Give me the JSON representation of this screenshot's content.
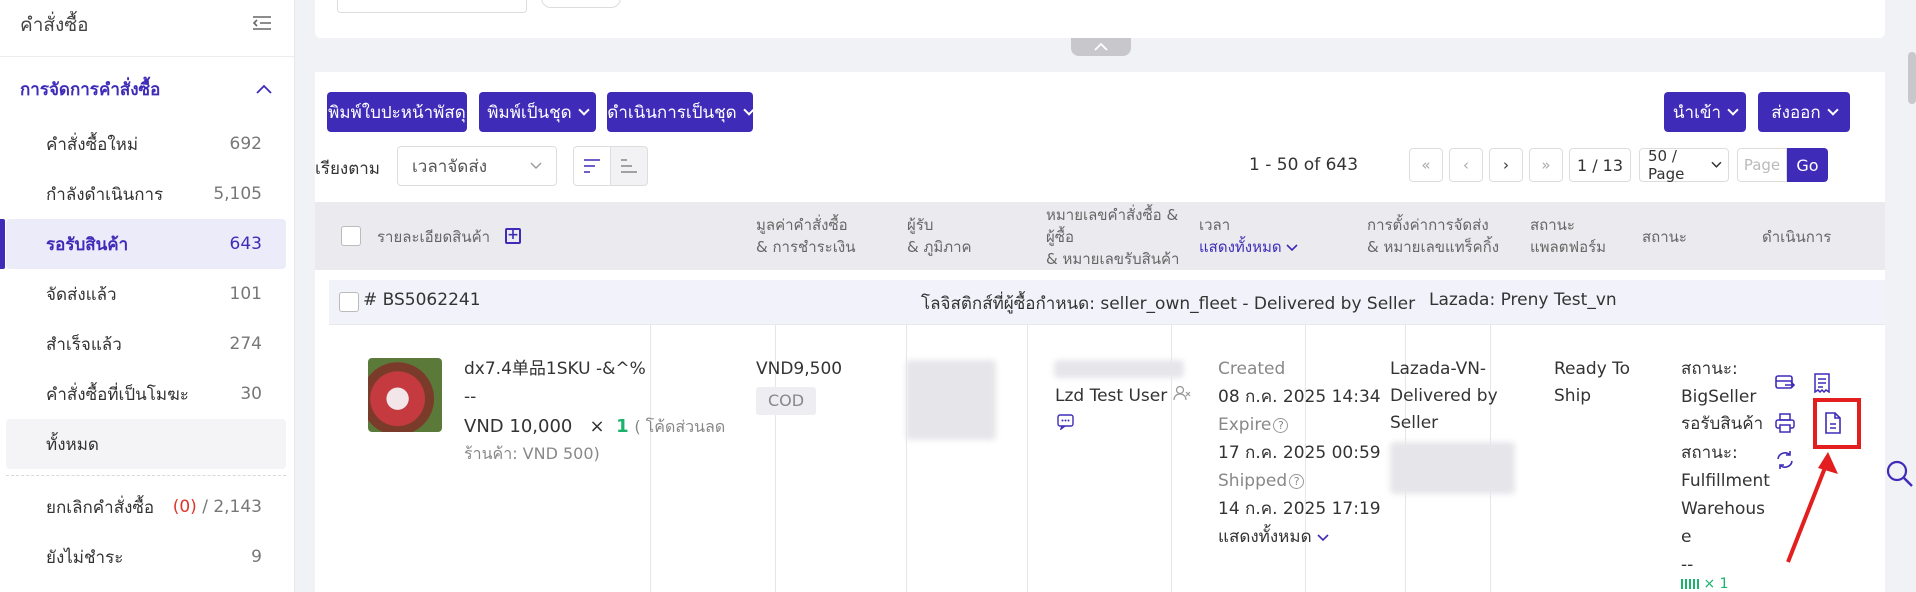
{
  "sidebar": {
    "title": "คำสั่งซื้อ",
    "section": "การจัดการคำสั่งซื้อ",
    "items": [
      {
        "label": "คำสั่งซื้อใหม่",
        "count": "692"
      },
      {
        "label": "กำลังดำเนินการ",
        "count": "5,105"
      },
      {
        "label": "รอรับสินค้า",
        "count": "643"
      },
      {
        "label": "จัดส่งแล้ว",
        "count": "101"
      },
      {
        "label": "สำเร็จแล้ว",
        "count": "274"
      },
      {
        "label": "คำสั่งซื้อที่เป็นโมฆะ",
        "count": "30"
      },
      {
        "label": "ทั้งหมด",
        "count": ""
      }
    ],
    "cancel": {
      "label": "ยกเลิกคำสั่งซื้อ",
      "count_red": "(0)",
      "sep": "/",
      "total": "2,143"
    },
    "unpaid": {
      "label": "ยังไม่ชำระ",
      "count": "9"
    }
  },
  "toolbar": {
    "print_label": "พิมพ์ใบปะหน้าพัสดุ",
    "print_batch": "พิมพ์เป็นชุด",
    "process_batch": "ดำเนินการเป็นชุด",
    "import": "นำเข้า",
    "export": "ส่งออก"
  },
  "sort": {
    "label": "เรียงตาม",
    "value": "เวลาจัดส่ง"
  },
  "pagination": {
    "range": "1 - 50 of 643",
    "page": "1 / 13",
    "per_page": "50 / Page",
    "goto_placeholder": "Page",
    "go": "Go"
  },
  "table": {
    "headers": {
      "product": "รายละเอียดสินค้า",
      "amount_1": "มูลค่าคำสั่งซื้อ",
      "amount_2": "& การชำระเงิน",
      "buyer_1": "ผู้รับ",
      "buyer_2": "& ภูมิภาค",
      "order_1": "หมายเลขคำสั่งซื้อ &",
      "order_2": "ผู้ซื้อ",
      "order_3": "& หมายเลขรับสินค้า",
      "time_1": "เวลา",
      "time_2": "แสดงทั้งหมด",
      "ship_1": "การตั้งค่าการจัดส่ง",
      "ship_2": "& หมายเลขแทร็คกิ้ง",
      "pstatus_1": "สถานะ",
      "pstatus_2": "แพลตฟอร์ม",
      "status": "สถานะ",
      "actions": "ดำเนินการ"
    },
    "order": {
      "id": "# BS5062241",
      "logistics": "โลจิสติกส์ที่ผู้ซื้อกำหนด: seller_own_fleet - Delivered by Seller",
      "store": "Lazada: Preny Test_vn",
      "product_name": "dx7.4单品1SKU -&^%",
      "product_sub": "--",
      "price": "VND 10,000",
      "times": "×",
      "qty": "1",
      "discount_1": "( โค้ดส่วนลด",
      "discount_2": "ร้านค้า: VND 500)",
      "amount": "VND9,500",
      "payment": "COD",
      "buyer": "Lzd Test User",
      "created_label": "Created",
      "created": "08 ก.ค. 2025 14:34",
      "expire_label": "Expire",
      "expire": "17 ก.ค. 2025 00:59",
      "shipped_label": "Shipped",
      "shipped": "14 ก.ค. 2025 17:19",
      "show_all": "แสดงทั้งหมด",
      "ship_1": "Lazada-VN-",
      "ship_2": "Delivered by",
      "ship_3": "Seller",
      "pstatus_1": "Ready To",
      "pstatus_2": "Ship",
      "status_1": "สถานะ:",
      "status_2": "BigSeller",
      "status_3": "รอรับสินค้า",
      "status_4": "สถานะ:",
      "status_5": "Fulfillment",
      "status_6": "Warehous",
      "status_7": "e",
      "status_8": "--",
      "status_9": "× 1"
    }
  },
  "colors": {
    "accent": "#3e2cb8",
    "highlight": "#e21e1e",
    "success": "#19b36b"
  }
}
